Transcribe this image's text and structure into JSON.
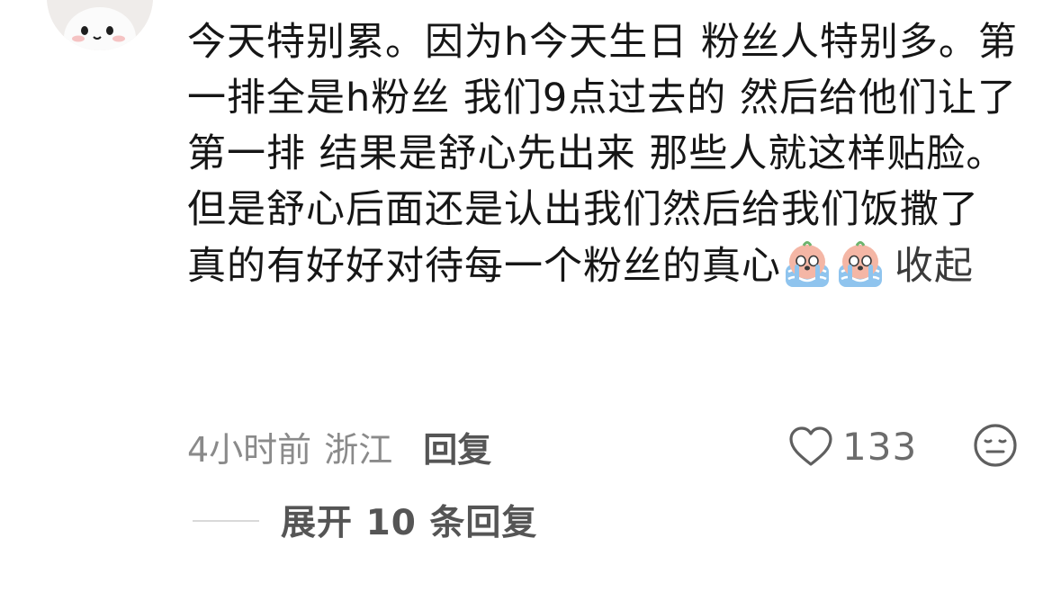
{
  "comment": {
    "text": "今天特别累。因为h今天生日 粉丝人特别多。第一排全是h粉丝 我们9点过去的 然后给他们让了第一排 结果是舒心先出来 那些人就这样贴脸。但是舒心后面还是认出我们然后给我们饭撒了 真的有好好对待每一个粉丝的真心",
    "emojis": [
      "crying-emoji",
      "crying-emoji"
    ],
    "collapse_label": "收起"
  },
  "meta": {
    "time": "4小时前",
    "location": "浙江",
    "reply_label": "回复"
  },
  "likes": {
    "count": "133",
    "icon": "heart-outline-icon"
  },
  "dislike": {
    "icon": "dislike-face-icon"
  },
  "replies": {
    "expand_label": "展开 10 条回复"
  },
  "colors": {
    "text": "#161616",
    "meta": "#8a8a8a",
    "action": "#555555",
    "emoji_body": "#f4b6a5",
    "emoji_tear": "#8fc4ee"
  }
}
